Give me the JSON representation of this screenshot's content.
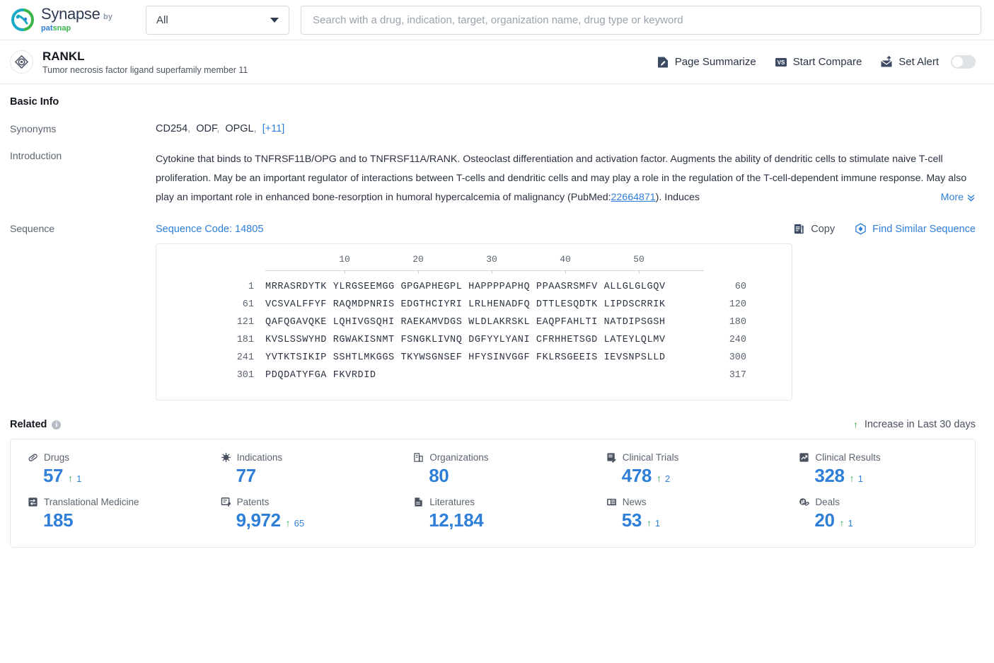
{
  "brand": {
    "name": "Synapse",
    "by": "by ",
    "pat": "pat",
    "snap": "snap",
    "logo_icon": "synapse-logo-icon"
  },
  "search": {
    "scope_value": "All",
    "placeholder": "Search with a drug, indication, target, organization name, drug type or keyword",
    "value": ""
  },
  "entity": {
    "icon": "target-icon",
    "title": "RANKL",
    "subtitle": "Tumor necrosis factor ligand superfamily member 11",
    "actions": [
      {
        "label": "Page Summarize",
        "icon": "summarize-icon"
      },
      {
        "label": "Start Compare",
        "icon": "vs-icon"
      },
      {
        "label": "Set Alert",
        "icon": "alert-mail-icon"
      }
    ],
    "alert_enabled": false
  },
  "basic_info": {
    "heading": "Basic Info",
    "synonyms_label": "Synonyms",
    "synonyms": [
      "CD254",
      "ODF",
      "OPGL"
    ],
    "synonyms_more": "[+11]",
    "introduction_label": "Introduction",
    "introduction_part1": "Cytokine that binds to TNFRSF11B/OPG and to TNFRSF11A/RANK. Osteoclast differentiation and activation factor. Augments the ability of dendritic cells to stimulate naive T-cell proliferation. May be an important regulator of interactions between T-cells and dendritic cells and may play a role in the regulation of the T-cell-dependent immune response. May also play an important role in enhanced bone-resorption in humoral hypercalcemia of malignancy (PubMed:",
    "introduction_pubmed": "22664871",
    "introduction_part2": "). Induces",
    "more_label": "More",
    "more_icon": "chevron-double-down-icon"
  },
  "sequence": {
    "label": "Sequence",
    "code_label": "Sequence Code: 14805",
    "copy_label": "Copy",
    "copy_icon": "copy-icon",
    "find_similar_label": "Find Similar Sequence",
    "find_similar_icon": "find-similar-icon",
    "ruler_ticks": [
      10,
      20,
      30,
      40,
      50
    ],
    "lines": [
      {
        "start": "1",
        "chunks": [
          "MRRASRDYTK",
          "YLRGSEEMGG",
          "GPGAPHEGPL",
          "HAPPPPAPHQ",
          "PPAASRSMFV",
          "ALLGLGLGQV"
        ],
        "end": "60"
      },
      {
        "start": "61",
        "chunks": [
          "VCSVALFFYF",
          "RAQMDPNRIS",
          "EDGTHCIYRI",
          "LRLHENADFQ",
          "DTTLESQDTK",
          "LIPDSCRRIK"
        ],
        "end": "120"
      },
      {
        "start": "121",
        "chunks": [
          "QAFQGAVQKE",
          "LQHIVGSQHI",
          "RAEKAMVDGS",
          "WLDLAKRSKL",
          "EAQPFAHLTI",
          "NATDIPSGSH"
        ],
        "end": "180"
      },
      {
        "start": "181",
        "chunks": [
          "KVSLSSWYHD",
          "RGWAKISNMT",
          "FSNGKLIVNQ",
          "DGFYYLYANI",
          "CFRHHETSGD",
          "LATEYLQLMV"
        ],
        "end": "240"
      },
      {
        "start": "241",
        "chunks": [
          "YVTKTSIKIP",
          "SSHTLMKGGS",
          "TKYWSGNSEF",
          "HFYSINVGGF",
          "FKLRSGEEIS",
          "IEVSNPSLLD"
        ],
        "end": "300"
      },
      {
        "start": "301",
        "chunks": [
          "PDQDATYFGA",
          "FKVRDID"
        ],
        "end": "317"
      }
    ]
  },
  "related": {
    "heading": "Related",
    "info_icon": "info-icon",
    "legend": "Increase in Last 30 days",
    "legend_icon": "arrow-up-icon",
    "stats": [
      {
        "label": "Drugs",
        "icon": "pill-icon",
        "value": "57",
        "delta": "1"
      },
      {
        "label": "Indications",
        "icon": "virus-icon",
        "value": "77",
        "delta": ""
      },
      {
        "label": "Organizations",
        "icon": "building-icon",
        "value": "80",
        "delta": ""
      },
      {
        "label": "Clinical Trials",
        "icon": "clipboard-edit-icon",
        "value": "478",
        "delta": "2"
      },
      {
        "label": "Clinical Results",
        "icon": "chart-doc-icon",
        "value": "328",
        "delta": "1"
      },
      {
        "label": "Translational Medicine",
        "icon": "transfer-doc-icon",
        "value": "185",
        "delta": ""
      },
      {
        "label": "Patents",
        "icon": "patent-icon",
        "value": "9,972",
        "delta": "65"
      },
      {
        "label": "Literatures",
        "icon": "document-icon",
        "value": "12,184",
        "delta": ""
      },
      {
        "label": "News",
        "icon": "news-icon",
        "value": "53",
        "delta": "1"
      },
      {
        "label": "Deals",
        "icon": "deals-icon",
        "value": "20",
        "delta": "1"
      }
    ]
  },
  "colors": {
    "accent_blue": "#2f7fd8",
    "green": "#2eab4f",
    "text_dark": "#13171f",
    "text_muted": "#5b6471"
  }
}
